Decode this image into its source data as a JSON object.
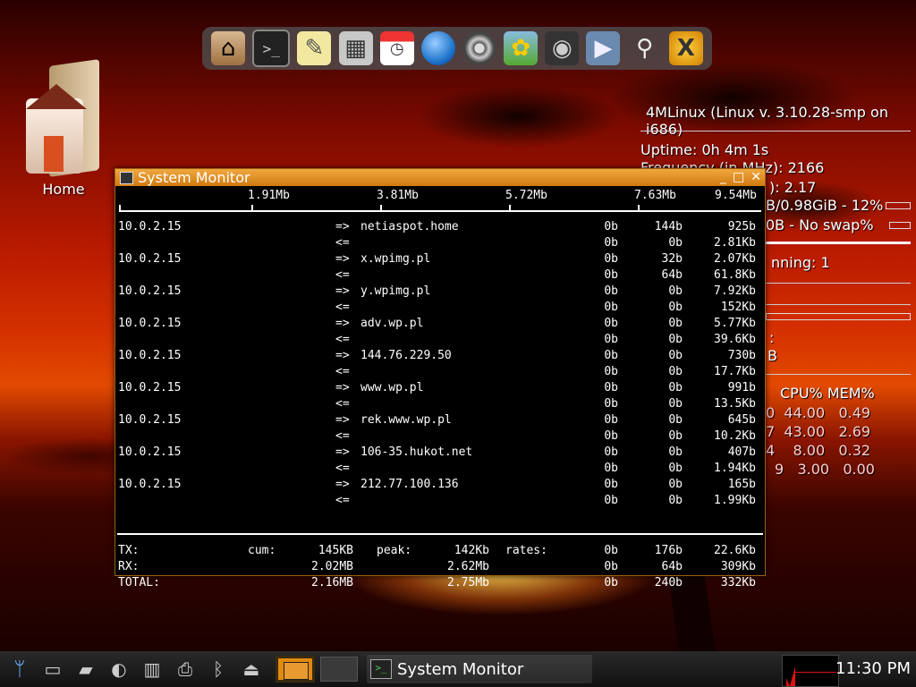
{
  "dock": {
    "items": [
      {
        "name": "home-folder-icon",
        "glyph": "⌂"
      },
      {
        "name": "terminal-icon",
        "glyph": ">_"
      },
      {
        "name": "text-editor-icon",
        "glyph": "✎"
      },
      {
        "name": "calculator-icon",
        "glyph": "▦"
      },
      {
        "name": "calendar-icon",
        "glyph": "◷"
      },
      {
        "name": "web-browser-icon",
        "glyph": ""
      },
      {
        "name": "media-player-icon",
        "glyph": ""
      },
      {
        "name": "image-viewer-icon",
        "glyph": "✿"
      },
      {
        "name": "camera-icon",
        "glyph": "◉"
      },
      {
        "name": "video-camera-icon",
        "glyph": "▶"
      },
      {
        "name": "search-icon",
        "glyph": "⚲"
      },
      {
        "name": "x-tools-icon",
        "glyph": "X"
      }
    ]
  },
  "desktop": {
    "home_label": "Home"
  },
  "conky": {
    "title": "4MLinux (Linux v. 3.10.28-smp on i686)",
    "uptime": "Uptime: 0h 4m 1s",
    "frequency": "Frequency (in MHz): 2166",
    "load": "): 2.17",
    "ram": "B/0.98GiB - 12%",
    "swap": "0B  - No swap%",
    "running": "nning: 1",
    "b_label": "B",
    "colon": ":",
    "table_header": "CPU%   MEM%",
    "table_rows": [
      {
        "pid_tail": "0",
        "cpu": "44.00",
        "mem": "0.49"
      },
      {
        "pid_tail": "7",
        "cpu": "43.00",
        "mem": "2.69"
      },
      {
        "pid_tail": "4",
        "cpu": "8.00",
        "mem": "0.32"
      },
      {
        "pid_tail": "9",
        "cpu": "3.00",
        "mem": "0.00"
      }
    ]
  },
  "window": {
    "title": "System Monitor",
    "minimize": "_",
    "maximize": "□",
    "close": "✕",
    "scale": [
      "1.91Mb",
      "3.81Mb",
      "5.72Mb",
      "7.63Mb",
      "9.54Mb"
    ],
    "connections": [
      {
        "src": "10.0.2.15",
        "dst": "netiaspot.home",
        "out": [
          "0b",
          "144b",
          "925b"
        ],
        "in": [
          "0b",
          "0b",
          "2.81Kb"
        ]
      },
      {
        "src": "10.0.2.15",
        "dst": "x.wpimg.pl",
        "out": [
          "0b",
          "32b",
          "2.07Kb"
        ],
        "in": [
          "0b",
          "64b",
          "61.8Kb"
        ]
      },
      {
        "src": "10.0.2.15",
        "dst": "y.wpimg.pl",
        "out": [
          "0b",
          "0b",
          "7.92Kb"
        ],
        "in": [
          "0b",
          "0b",
          "152Kb"
        ]
      },
      {
        "src": "10.0.2.15",
        "dst": "adv.wp.pl",
        "out": [
          "0b",
          "0b",
          "5.77Kb"
        ],
        "in": [
          "0b",
          "0b",
          "39.6Kb"
        ]
      },
      {
        "src": "10.0.2.15",
        "dst": "144.76.229.50",
        "out": [
          "0b",
          "0b",
          "730b"
        ],
        "in": [
          "0b",
          "0b",
          "17.7Kb"
        ]
      },
      {
        "src": "10.0.2.15",
        "dst": "www.wp.pl",
        "out": [
          "0b",
          "0b",
          "991b"
        ],
        "in": [
          "0b",
          "0b",
          "13.5Kb"
        ]
      },
      {
        "src": "10.0.2.15",
        "dst": "rek.www.wp.pl",
        "out": [
          "0b",
          "0b",
          "645b"
        ],
        "in": [
          "0b",
          "0b",
          "10.2Kb"
        ]
      },
      {
        "src": "10.0.2.15",
        "dst": "106-35.hukot.net",
        "out": [
          "0b",
          "0b",
          "407b"
        ],
        "in": [
          "0b",
          "0b",
          "1.94Kb"
        ]
      },
      {
        "src": "10.0.2.15",
        "dst": "212.77.100.136",
        "out": [
          "0b",
          "0b",
          "165b"
        ],
        "in": [
          "0b",
          "0b",
          "1.99Kb"
        ]
      }
    ],
    "arrow_out": "=>",
    "arrow_in": "<=",
    "footer": {
      "tx_label": "TX:",
      "rx_label": "RX:",
      "total_label": "TOTAL:",
      "cum_label": "cum:",
      "peak_label": "peak:",
      "rates_label": "rates:",
      "tx": {
        "cum": "145KB",
        "peak": "142Kb",
        "rates": [
          "0b",
          "176b",
          "22.6Kb"
        ]
      },
      "rx": {
        "cum": "2.02MB",
        "peak": "2.62Mb",
        "rates": [
          "0b",
          "64b",
          "309Kb"
        ]
      },
      "total": {
        "cum": "2.16MB",
        "peak": "2.75Mb",
        "rates": [
          "0b",
          "240b",
          "332Kb"
        ]
      }
    }
  },
  "taskbar": {
    "task_label": "System Monitor",
    "clock": "11:30 PM"
  }
}
